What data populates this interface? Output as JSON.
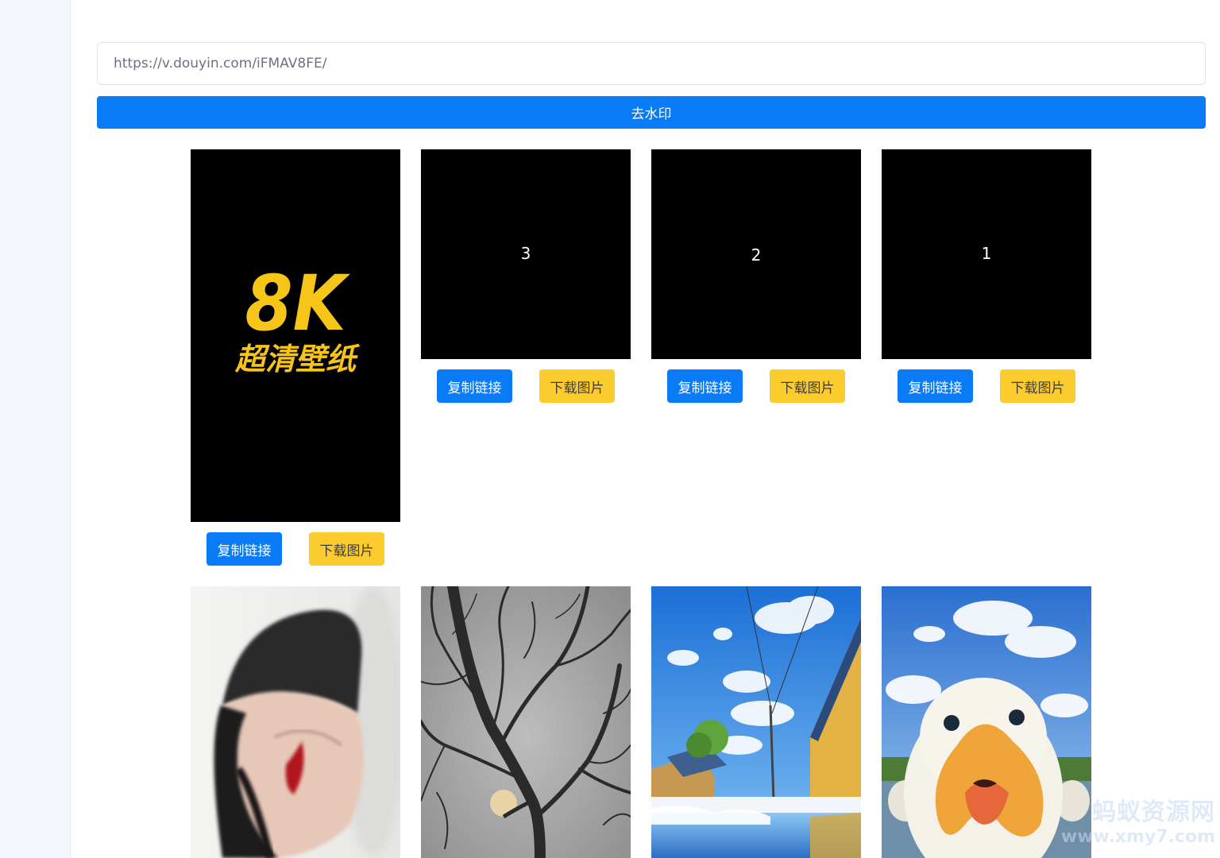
{
  "search": {
    "value": "https://v.douyin.com/iFMAV8FE/"
  },
  "submit_label": "去水印",
  "cover": {
    "title": "8K",
    "subtitle": "超清壁纸"
  },
  "cards": [
    {
      "number": "3"
    },
    {
      "number": "2"
    },
    {
      "number": "1"
    }
  ],
  "buttons": {
    "copy_label": "复制链接",
    "download_label": "下载图片"
  },
  "watermark": {
    "line1": "蚂蚁资源网",
    "line2": "www.xmy7.com"
  },
  "colors": {
    "primary": "#0a7bf7",
    "warning": "#fccb2e",
    "cover_text": "#f7c418"
  }
}
